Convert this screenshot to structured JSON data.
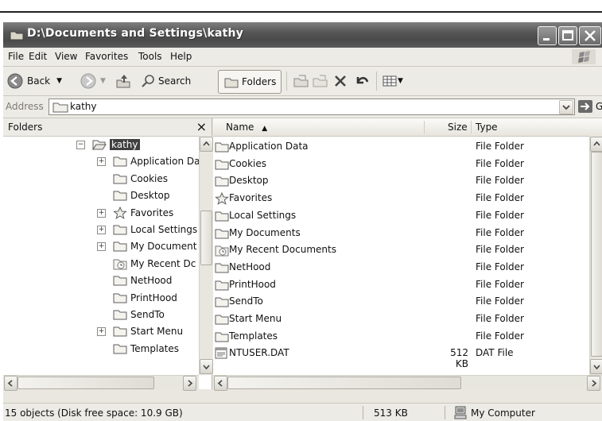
{
  "window": {
    "title": "D:\\Documents and Settings\\kathy"
  },
  "menu": [
    "File",
    "Edit",
    "View",
    "Favorites",
    "Tools",
    "Help"
  ],
  "toolbar": {
    "back_label": "Back",
    "search_label": "Search",
    "folders_label": "Folders"
  },
  "address": {
    "label": "Address",
    "value": "kathy",
    "go_label": "Go"
  },
  "folders_pane": {
    "title": "Folders",
    "tree": [
      {
        "label": "kathy",
        "expander": "minus",
        "selected": true,
        "icon": "folder-open-icon"
      },
      {
        "label": "Application Da",
        "expander": "plus",
        "icon": "folder-icon"
      },
      {
        "label": "Cookies",
        "expander": "",
        "icon": "folder-icon"
      },
      {
        "label": "Desktop",
        "expander": "",
        "icon": "folder-icon"
      },
      {
        "label": "Favorites",
        "expander": "plus",
        "icon": "star-icon"
      },
      {
        "label": "Local Settings",
        "expander": "plus",
        "icon": "folder-icon"
      },
      {
        "label": "My Document",
        "expander": "plus",
        "icon": "folder-icon"
      },
      {
        "label": "My Recent Dc",
        "expander": "",
        "icon": "recent-docs-icon"
      },
      {
        "label": "NetHood",
        "expander": "",
        "icon": "folder-icon"
      },
      {
        "label": "PrintHood",
        "expander": "",
        "icon": "folder-icon"
      },
      {
        "label": "SendTo",
        "expander": "",
        "icon": "folder-icon"
      },
      {
        "label": "Start Menu",
        "expander": "plus",
        "icon": "folder-icon"
      },
      {
        "label": "Templates",
        "expander": "",
        "icon": "folder-icon"
      }
    ]
  },
  "file_list": {
    "columns": [
      "Name",
      "Size",
      "Type"
    ],
    "sort_indicator": "▲",
    "rows": [
      {
        "name": "Application Data",
        "size": "",
        "type": "File Folder",
        "icon": "folder-icon"
      },
      {
        "name": "Cookies",
        "size": "",
        "type": "File Folder",
        "icon": "folder-icon"
      },
      {
        "name": "Desktop",
        "size": "",
        "type": "File Folder",
        "icon": "folder-icon"
      },
      {
        "name": "Favorites",
        "size": "",
        "type": "File Folder",
        "icon": "star-icon"
      },
      {
        "name": "Local Settings",
        "size": "",
        "type": "File Folder",
        "icon": "folder-icon"
      },
      {
        "name": "My Documents",
        "size": "",
        "type": "File Folder",
        "icon": "folder-icon"
      },
      {
        "name": "My Recent Documents",
        "size": "",
        "type": "File Folder",
        "icon": "recent-docs-icon"
      },
      {
        "name": "NetHood",
        "size": "",
        "type": "File Folder",
        "icon": "folder-icon"
      },
      {
        "name": "PrintHood",
        "size": "",
        "type": "File Folder",
        "icon": "folder-icon"
      },
      {
        "name": "SendTo",
        "size": "",
        "type": "File Folder",
        "icon": "folder-icon"
      },
      {
        "name": "Start Menu",
        "size": "",
        "type": "File Folder",
        "icon": "folder-icon"
      },
      {
        "name": "Templates",
        "size": "",
        "type": "File Folder",
        "icon": "folder-icon"
      },
      {
        "name": "NTUSER.DAT",
        "size": "512 KB",
        "type": "DAT File",
        "icon": "dat-file-icon"
      }
    ]
  },
  "status": {
    "objects": "15 objects (Disk free space: 10.9 GB)",
    "size": "513 KB",
    "zone": "My Computer"
  }
}
